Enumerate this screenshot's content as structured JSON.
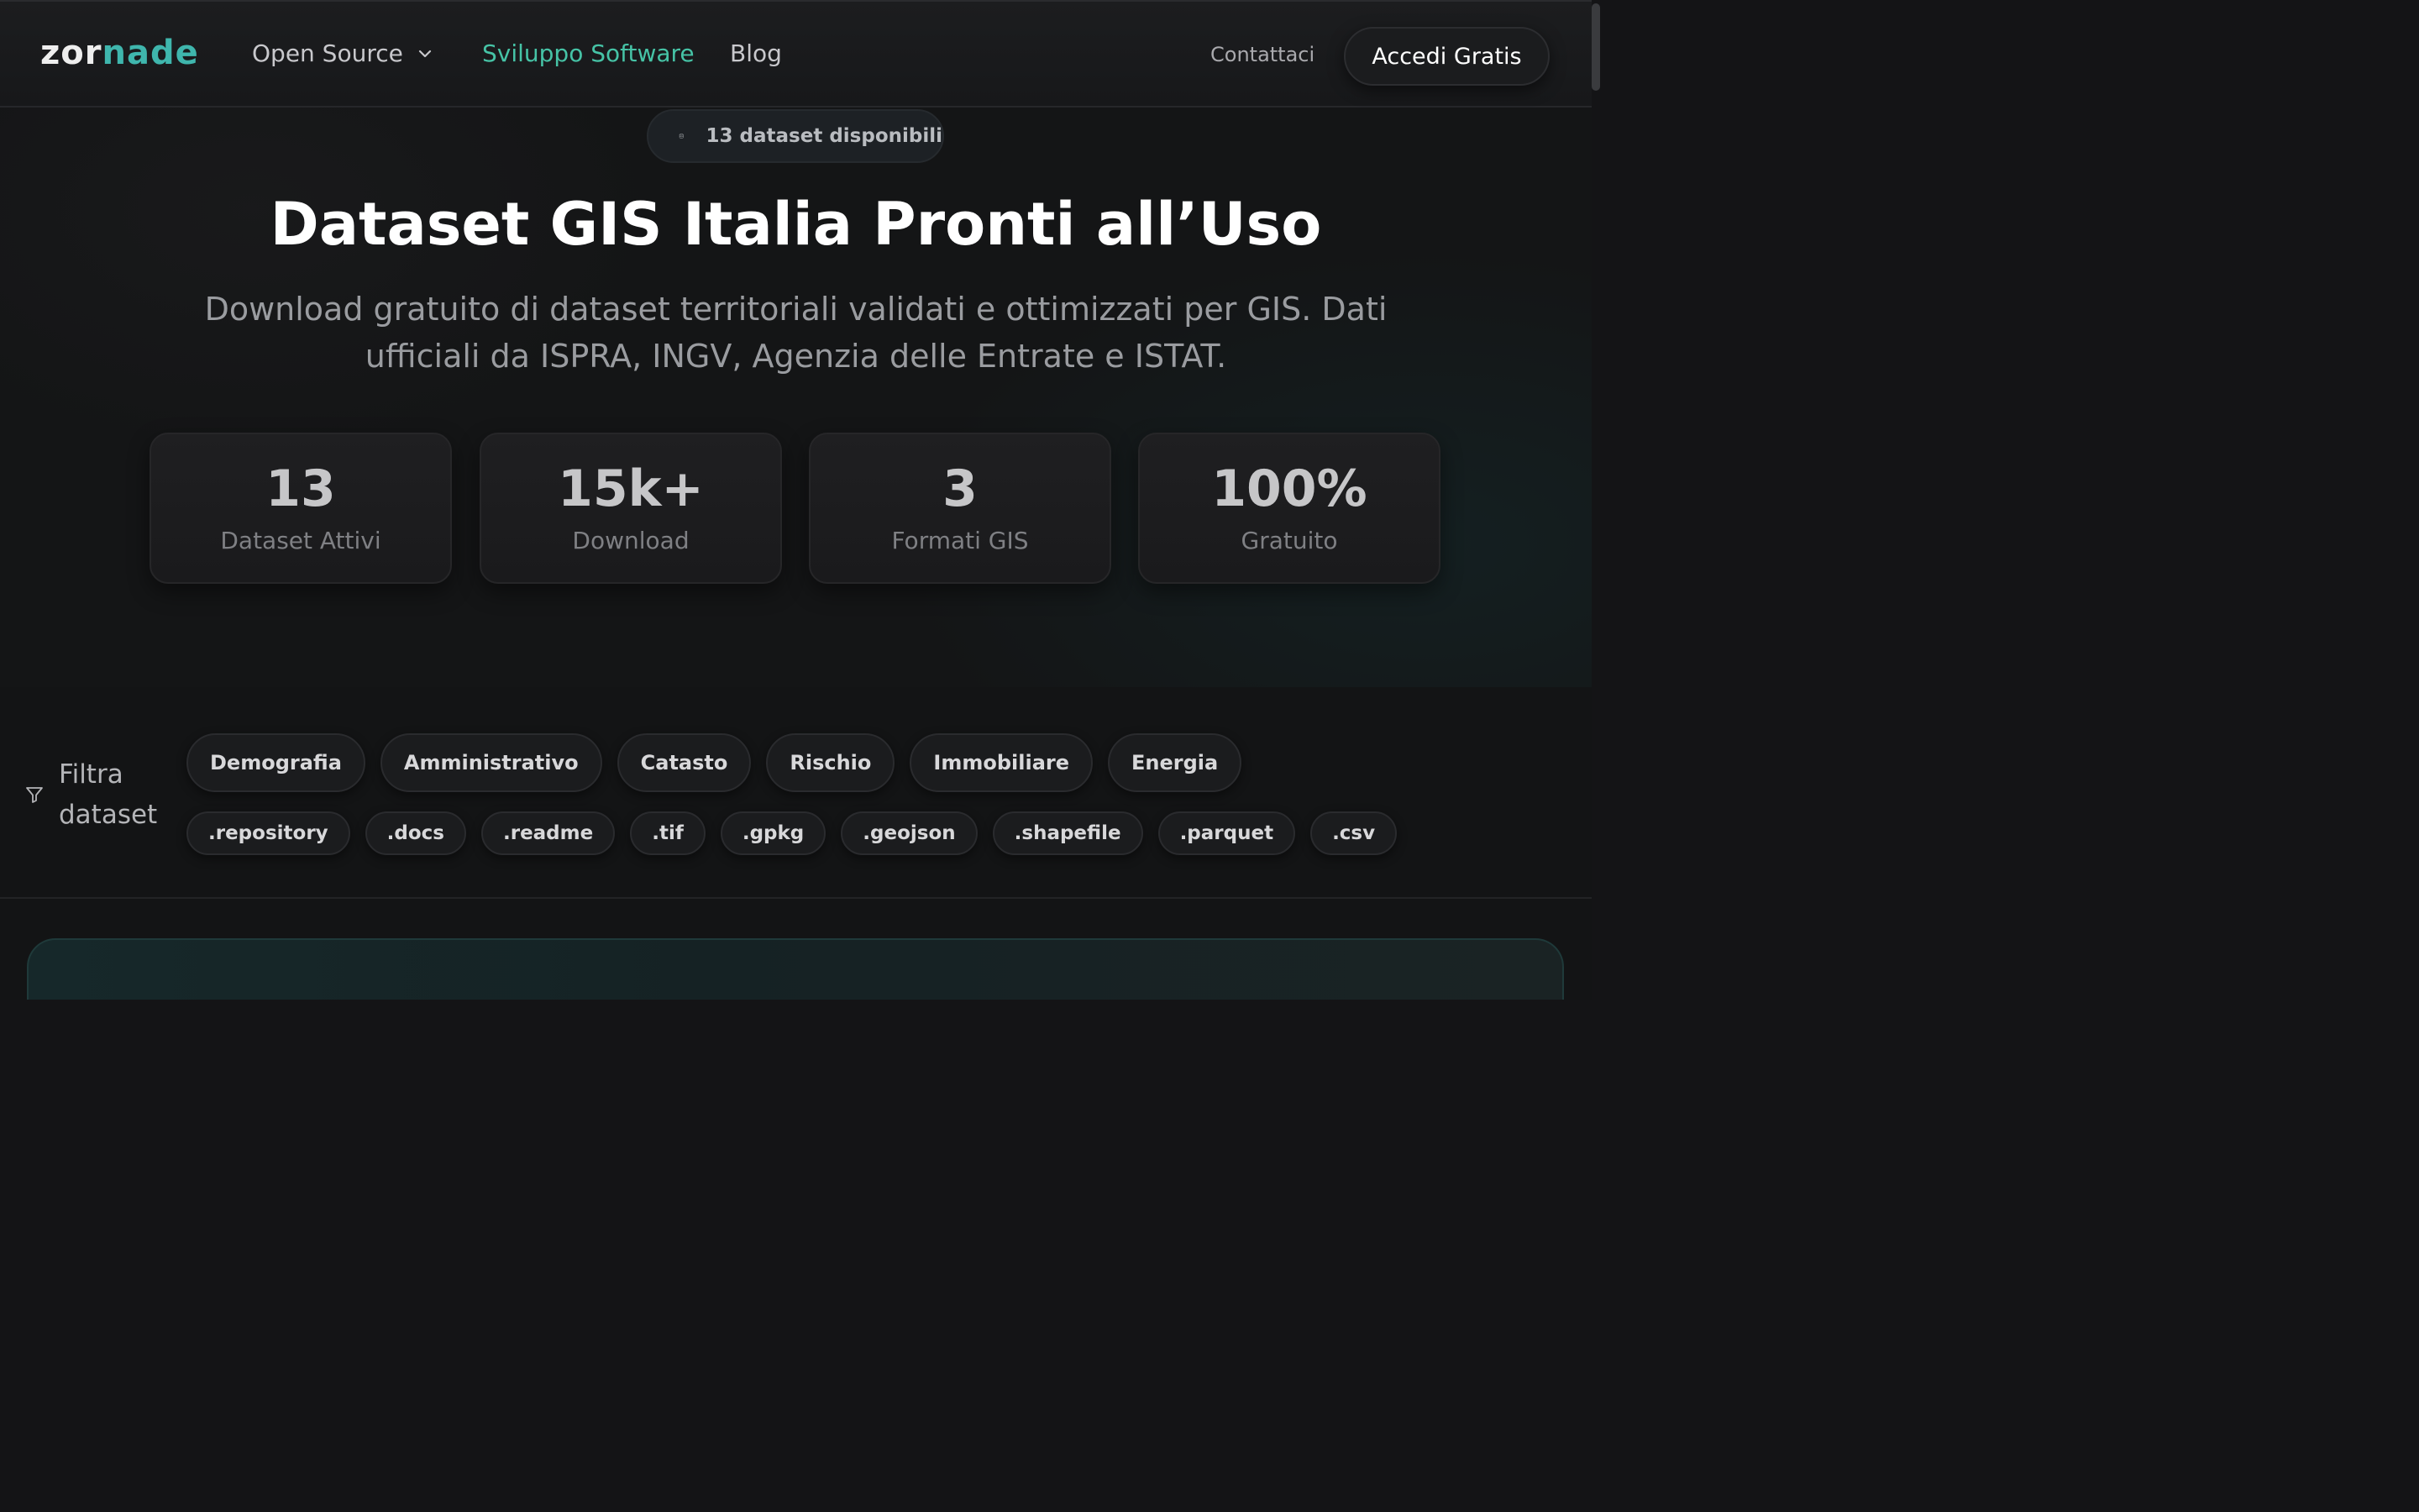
{
  "nav": {
    "logo_part1": "zor",
    "logo_part2": "nade",
    "links": [
      {
        "label": "Open Source"
      },
      {
        "label": "Sviluppo Software"
      },
      {
        "label": "Blog"
      }
    ],
    "contact": "Contattaci",
    "cta": "Accedi Gratis",
    "active_color": "#46c3a6",
    "logo_accent": "#3fb6ad"
  },
  "hero": {
    "badge": "13 dataset disponibili",
    "title": "Dataset GIS Italia Pronti all’Uso",
    "subtitle": "Download gratuito di dataset territoriali validati e ottimizzati per GIS. Dati ufficiali da ISPRA, INGV, Agenzia delle Entrate e ISTAT.",
    "stats": [
      {
        "value": "13",
        "label": "Dataset Attivi"
      },
      {
        "value": "15k+",
        "label": "Download"
      },
      {
        "value": "3",
        "label": "Formati GIS"
      },
      {
        "value": "100%",
        "label": "Gratuito"
      }
    ]
  },
  "filters": {
    "label_line1": "Filtra",
    "label_line2": "dataset",
    "categories": [
      "Demografia",
      "Amministrativo",
      "Catasto",
      "Rischio",
      "Immobiliare",
      "Energia"
    ],
    "formats": [
      ".repository",
      ".docs",
      ".readme",
      ".tif",
      ".gpkg",
      ".geojson",
      ".shapefile",
      ".parquet",
      ".csv"
    ]
  }
}
